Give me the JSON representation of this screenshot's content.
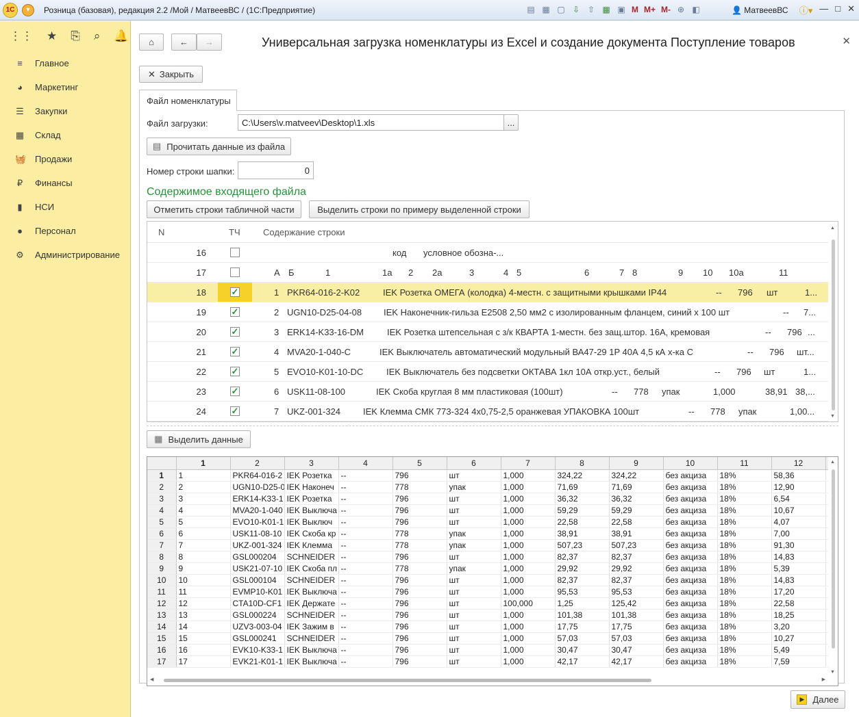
{
  "window": {
    "logo": "1С",
    "title": "Розница (базовая), редакция 2.2 /Мой / МатвеевВС /  (1С:Предприятие)",
    "user": "МатвеевВС",
    "toolbar_m": [
      "M",
      "M+",
      "M-"
    ]
  },
  "sidebar": {
    "items": [
      {
        "label": "Главное",
        "icon": "menu-lines-icon"
      },
      {
        "label": "Маркетинг",
        "icon": "pie-chart-icon"
      },
      {
        "label": "Закупки",
        "icon": "list-icon"
      },
      {
        "label": "Склад",
        "icon": "grid-icon"
      },
      {
        "label": "Продажи",
        "icon": "basket-icon"
      },
      {
        "label": "Финансы",
        "icon": "ruble-icon"
      },
      {
        "label": "НСИ",
        "icon": "book-icon"
      },
      {
        "label": "Персонал",
        "icon": "person-icon"
      },
      {
        "label": "Администрирование",
        "icon": "gear-icon"
      }
    ]
  },
  "form": {
    "title": "Универсальная загрузка номенклатуры из Excel и создание документа Поступление товаров",
    "close_btn": "Закрыть",
    "tab": "Файл номенклатуры",
    "file_label": "Файл загрузки:",
    "file_value": "C:\\Users\\v.matveev\\Desktop\\1.xls",
    "file_select_btn": "...",
    "read_btn": "Прочитать данные из файла",
    "header_row_label": "Номер строки шапки:",
    "header_row_value": "0",
    "content_heading": "Содержимое входящего файла",
    "mark_btn": "Отметить строки табличной части",
    "select_by_example_btn": "Выделить строки по примеру выделенной строки",
    "select_data_btn": "Выделить данные",
    "next_btn": "Далее"
  },
  "grid1": {
    "headers": [
      "N",
      "ТЧ",
      "Содержание строки"
    ],
    "rows": [
      {
        "n": "16",
        "checked": false,
        "selected": false,
        "parts": [
          [
            "код",
            358
          ],
          [
            "условное обозна-...",
            403
          ]
        ]
      },
      {
        "n": "17",
        "checked": false,
        "selected": false,
        "parts": [
          [
            "А",
            185
          ],
          [
            "Б",
            206
          ],
          [
            "1",
            260
          ],
          [
            "1а",
            343
          ],
          [
            "2",
            381
          ],
          [
            "2а",
            416
          ],
          [
            "3",
            470
          ],
          [
            "4",
            520
          ],
          [
            "5",
            539
          ],
          [
            "6",
            638
          ],
          [
            "7",
            689
          ],
          [
            "8",
            708
          ],
          [
            "9",
            775
          ],
          [
            "10",
            811
          ],
          [
            "10а",
            849
          ],
          [
            "11",
            922
          ]
        ]
      },
      {
        "n": "18",
        "checked": true,
        "selected": true,
        "parts": [
          [
            "1",
            185
          ],
          [
            "PKR64-016-2-K02",
            204
          ],
          [
            "IEK Розетка ОМЕГА (колодка) 4-местн. с защитными крышками IP44",
            344
          ],
          [
            "--",
            830
          ],
          [
            "796",
            862
          ],
          [
            "шт",
            904
          ],
          [
            "1...",
            960
          ]
        ]
      },
      {
        "n": "19",
        "checked": true,
        "selected": false,
        "parts": [
          [
            "2",
            185
          ],
          [
            "UGN10-D25-04-08",
            204
          ],
          [
            "IEK Наконечник-гильза E2508 2,50 мм2 с изолированным фланцем, синий х 100 шт",
            345
          ],
          [
            "--",
            928
          ],
          [
            "7...",
            958
          ]
        ]
      },
      {
        "n": "20",
        "checked": true,
        "selected": false,
        "parts": [
          [
            "3",
            185
          ],
          [
            "ERK14-K33-16-DM",
            204
          ],
          [
            "IEK Розетка штепсельная с з/к КВАРТА 1-местн. без защ.штор. 16А, кремовая",
            350
          ],
          [
            "--",
            902
          ],
          [
            "796",
            934
          ],
          [
            "...",
            964
          ]
        ]
      },
      {
        "n": "21",
        "checked": true,
        "selected": false,
        "parts": [
          [
            "4",
            185
          ],
          [
            "MVA20-1-040-C",
            204
          ],
          [
            "IEK Выключатель автоматический модульный ВА47-29 1P 40А 4,5 кА х-ка С",
            339
          ],
          [
            "--",
            876
          ],
          [
            "796",
            908
          ],
          [
            "шт...",
            948
          ]
        ]
      },
      {
        "n": "22",
        "checked": true,
        "selected": false,
        "parts": [
          [
            "5",
            185
          ],
          [
            "EVO10-K01-10-DC",
            204
          ],
          [
            "IEK Выключатель без подсветки ОКТАВА 1кл 10А откр.уст., белый",
            349
          ],
          [
            "--",
            828
          ],
          [
            "796",
            860
          ],
          [
            "шт",
            900
          ],
          [
            "1...",
            958
          ]
        ]
      },
      {
        "n": "23",
        "checked": true,
        "selected": false,
        "parts": [
          [
            "6",
            185
          ],
          [
            "USK11-08-100",
            204
          ],
          [
            "IEK Скоба круглая 8 мм пластиковая (100шт)",
            334
          ],
          [
            "--",
            678
          ],
          [
            "778",
            710
          ],
          [
            "упак",
            751
          ],
          [
            "1,000",
            826
          ],
          [
            "38,91",
            902
          ],
          [
            "38,...",
            946
          ]
        ]
      },
      {
        "n": "24",
        "checked": true,
        "selected": false,
        "parts": [
          [
            "7",
            185
          ],
          [
            "UKZ-001-324",
            204
          ],
          [
            "IEK Клемма СМК 773-324 4х0,75-2,5 оранжевая УПАКОВКА 100шт",
            315
          ],
          [
            "--",
            790
          ],
          [
            "778",
            822
          ],
          [
            "упак",
            863
          ],
          [
            "1,00...",
            938
          ]
        ]
      }
    ]
  },
  "grid2": {
    "columns": [
      "1",
      "2",
      "3",
      "4",
      "5",
      "6",
      "7",
      "8",
      "9",
      "10",
      "11",
      "12"
    ],
    "rows": [
      [
        "1",
        "1",
        "PKR64-016-2",
        "IEK Розетка",
        "--",
        "796",
        "шт",
        "1,000",
        "324,22",
        "324,22",
        "без акциза",
        "18%",
        "58,36"
      ],
      [
        "2",
        "2",
        "UGN10-D25-0",
        "IEK Наконеч",
        "--",
        "778",
        "упак",
        "1,000",
        "71,69",
        "71,69",
        "без акциза",
        "18%",
        "12,90"
      ],
      [
        "3",
        "3",
        "ERK14-K33-1",
        "IEK Розетка",
        "--",
        "796",
        "шт",
        "1,000",
        "36,32",
        "36,32",
        "без акциза",
        "18%",
        "6,54"
      ],
      [
        "4",
        "4",
        "MVA20-1-040",
        "IEK Выключа",
        "--",
        "796",
        "шт",
        "1,000",
        "59,29",
        "59,29",
        "без акциза",
        "18%",
        "10,67"
      ],
      [
        "5",
        "5",
        "EVO10-K01-1",
        "IEK Выключ",
        "--",
        "796",
        "шт",
        "1,000",
        "22,58",
        "22,58",
        "без акциза",
        "18%",
        "4,07"
      ],
      [
        "6",
        "6",
        "USK11-08-10",
        "IEK Скоба кр",
        "--",
        "778",
        "упак",
        "1,000",
        "38,91",
        "38,91",
        "без акциза",
        "18%",
        "7,00"
      ],
      [
        "7",
        "7",
        "UKZ-001-324",
        "IEK Клемма",
        "--",
        "778",
        "упак",
        "1,000",
        "507,23",
        "507,23",
        "без акциза",
        "18%",
        "91,30"
      ],
      [
        "8",
        "8",
        "GSL000204",
        "SCHNEIDER",
        "--",
        "796",
        "шт",
        "1,000",
        "82,37",
        "82,37",
        "без акциза",
        "18%",
        "14,83"
      ],
      [
        "9",
        "9",
        "USK21-07-10",
        "IEK Скоба пл",
        "--",
        "778",
        "упак",
        "1,000",
        "29,92",
        "29,92",
        "без акциза",
        "18%",
        "5,39"
      ],
      [
        "10",
        "10",
        "GSL000104",
        "SCHNEIDER",
        "--",
        "796",
        "шт",
        "1,000",
        "82,37",
        "82,37",
        "без акциза",
        "18%",
        "14,83"
      ],
      [
        "11",
        "11",
        "EVMP10-K01",
        "IEK Выключа",
        "--",
        "796",
        "шт",
        "1,000",
        "95,53",
        "95,53",
        "без акциза",
        "18%",
        "17,20"
      ],
      [
        "12",
        "12",
        "CTA10D-CF1",
        "IEK Держате",
        "--",
        "796",
        "шт",
        "100,000",
        "1,25",
        "125,42",
        "без акциза",
        "18%",
        "22,58"
      ],
      [
        "13",
        "13",
        "GSL000224",
        "SCHNEIDER",
        "--",
        "796",
        "шт",
        "1,000",
        "101,38",
        "101,38",
        "без акциза",
        "18%",
        "18,25"
      ],
      [
        "14",
        "14",
        "UZV3-003-04",
        "IEK Зажим в",
        "--",
        "796",
        "шт",
        "1,000",
        "17,75",
        "17,75",
        "без акциза",
        "18%",
        "3,20"
      ],
      [
        "15",
        "15",
        "GSL000241",
        "SCHNEIDER",
        "--",
        "796",
        "шт",
        "1,000",
        "57,03",
        "57,03",
        "без акциза",
        "18%",
        "10,27"
      ],
      [
        "16",
        "16",
        "EVK10-K33-1",
        "IEK Выключа",
        "--",
        "796",
        "шт",
        "1,000",
        "30,47",
        "30,47",
        "без акциза",
        "18%",
        "5,49"
      ],
      [
        "17",
        "17",
        "EVK21-K01-1",
        "IEK Выключа",
        "--",
        "796",
        "шт",
        "1,000",
        "42,17",
        "42,17",
        "без акциза",
        "18%",
        "7,59"
      ]
    ]
  },
  "colors": {
    "sidebar_bg": "#fbeea3",
    "selected_row": "#f9efa4",
    "accent_green": "#2b8f3c"
  }
}
